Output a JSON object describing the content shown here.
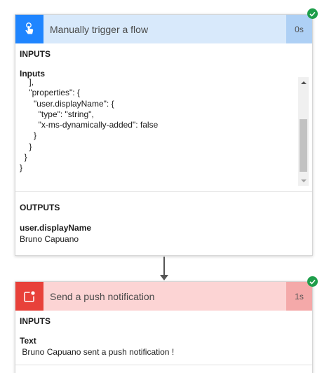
{
  "trigger_card": {
    "title": "Manually trigger a flow",
    "duration": "0s",
    "inputs_heading": "INPUTS",
    "inputs_label": "Inputs",
    "inputs_code": "    ],\n    \"properties\": {\n      \"user.displayName\": {\n        \"type\": \"string\",\n        \"x-ms-dynamically-added\": false\n      }\n    }\n  }\n}",
    "outputs_heading": "OUTPUTS",
    "output_field_label": "user.displayName",
    "output_field_value": "Bruno Capuano",
    "status": "succeeded",
    "icon": "hand-tap-icon"
  },
  "notification_card": {
    "title": "Send a push notification",
    "duration": "1s",
    "inputs_heading": "INPUTS",
    "input_field_label": "Text",
    "input_field_value": " Bruno Capuano sent a push notification !",
    "status": "succeeded",
    "icon": "notification-icon"
  },
  "colors": {
    "trigger_accent": "#1f85ff",
    "trigger_header": "#d8e9fb",
    "notification_accent": "#e8413a",
    "notification_header": "#fcd4d4",
    "success": "#1f9e4b"
  }
}
